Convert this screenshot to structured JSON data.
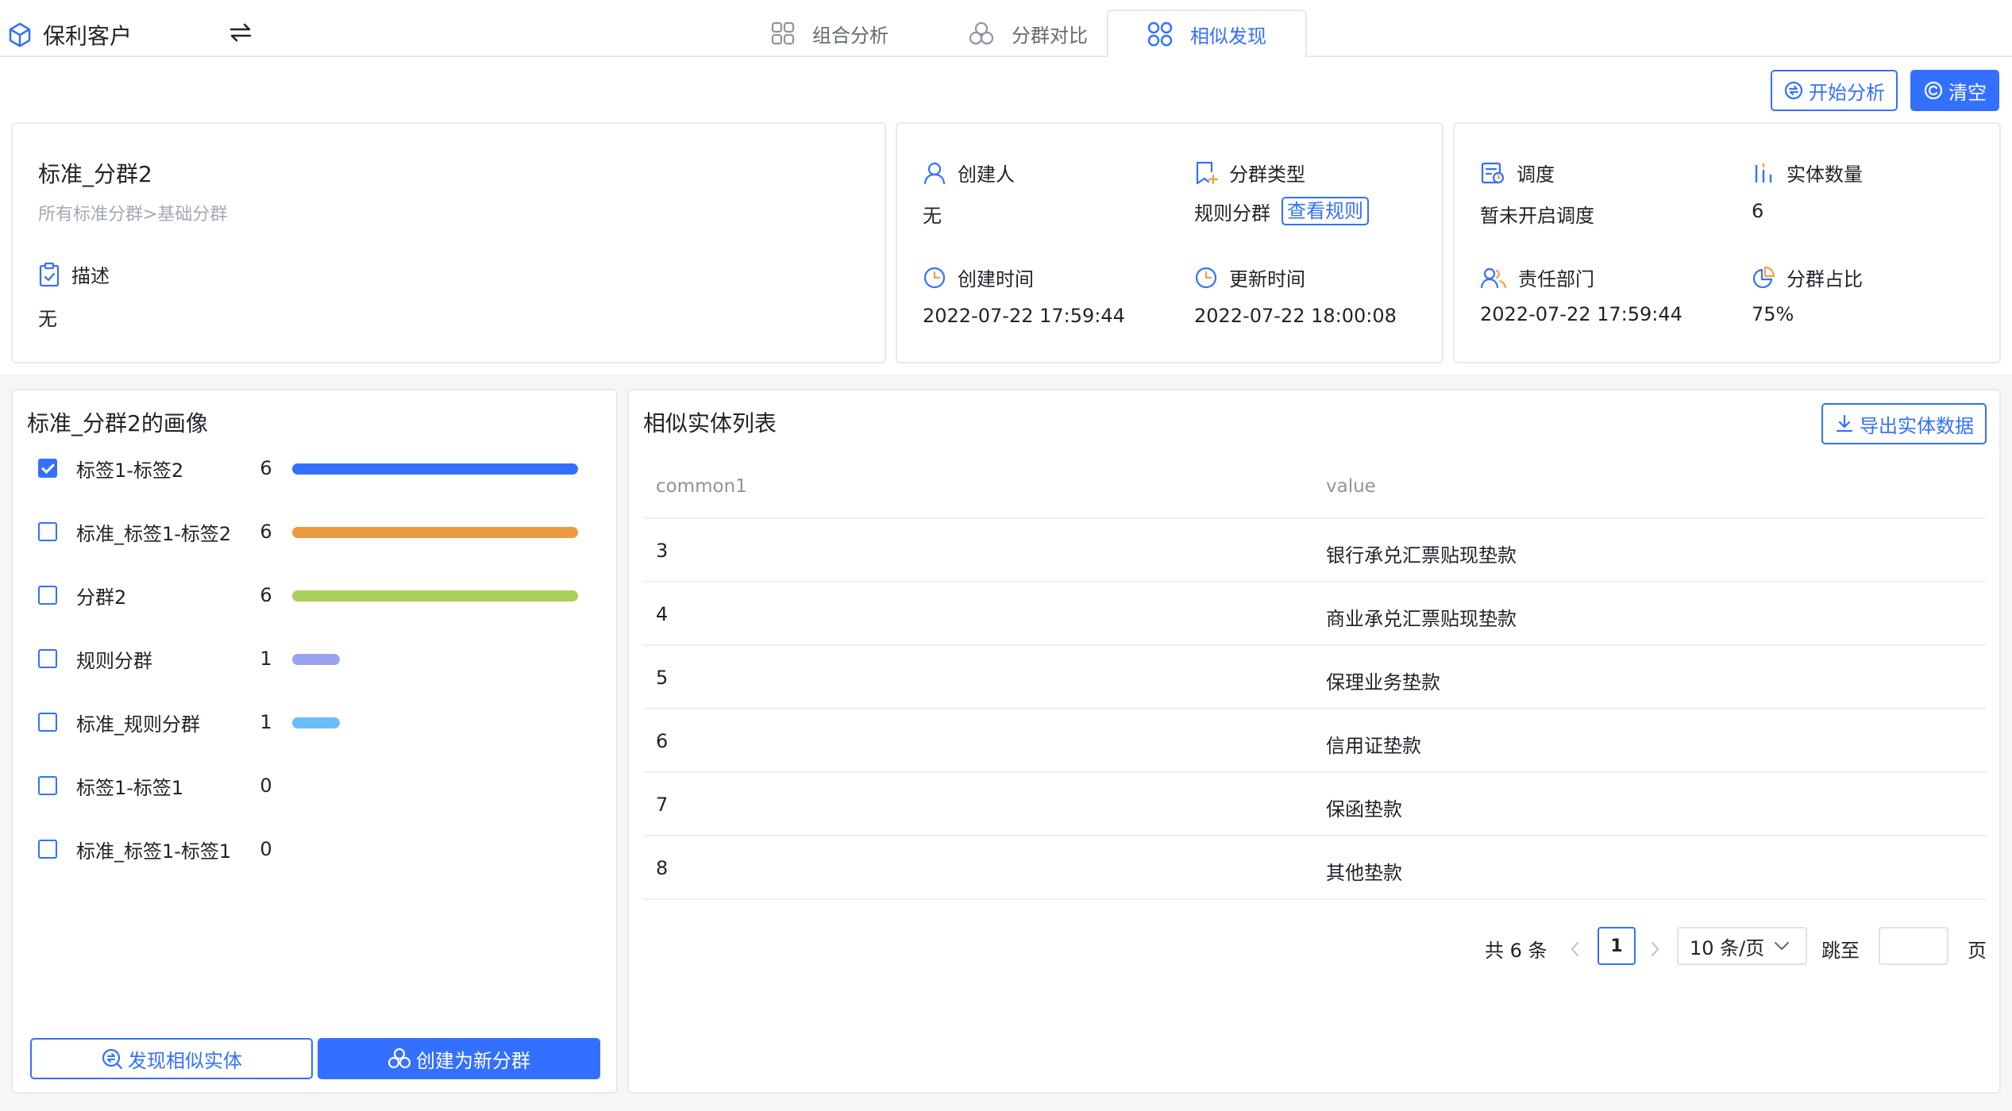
{
  "header": {
    "app_title": "保利客户",
    "tabs": [
      {
        "label": "组合分析",
        "active": false
      },
      {
        "label": "分群对比",
        "active": false
      },
      {
        "label": "相似发现",
        "active": true
      }
    ]
  },
  "actions": {
    "start_analysis": "开始分析",
    "clear": "清空"
  },
  "segment": {
    "name": "标准_分群2",
    "path": "所有标准分群>基础分群",
    "description_label": "描述",
    "description_value": "无"
  },
  "meta1": {
    "creator_label": "创建人",
    "creator_value": "无",
    "type_label": "分群类型",
    "type_value": "规则分群",
    "view_rule": "查看规则",
    "created_label": "创建时间",
    "created_value": "2022-07-22 17:59:44",
    "updated_label": "更新时间",
    "updated_value": "2022-07-22 18:00:08"
  },
  "meta2": {
    "schedule_label": "调度",
    "schedule_value": "暂未开启调度",
    "entity_count_label": "实体数量",
    "entity_count_value": "6",
    "dept_label": "责任部门",
    "dept_value": "2022-07-22 17:59:44",
    "ratio_label": "分群占比",
    "ratio_value": "75%"
  },
  "portrait": {
    "title": "标准_分群2的画像",
    "tags": [
      {
        "label": "标签1-标签2",
        "count": "6",
        "value": 6,
        "checked": true,
        "color": "#3370ff"
      },
      {
        "label": "标准_标签1-标签2",
        "count": "6",
        "value": 6,
        "checked": false,
        "color": "#eb9a3f"
      },
      {
        "label": "分群2",
        "count": "6",
        "value": 6,
        "checked": false,
        "color": "#a8d05a"
      },
      {
        "label": "规则分群",
        "count": "1",
        "value": 1,
        "checked": false,
        "color": "#9aa3ef"
      },
      {
        "label": "标准_规则分群",
        "count": "1",
        "value": 1,
        "checked": false,
        "color": "#6bbdf7"
      },
      {
        "label": "标签1-标签1",
        "count": "0",
        "value": 0,
        "checked": false,
        "color": "#3370ff"
      },
      {
        "label": "标准_标签1-标签1",
        "count": "0",
        "value": 0,
        "checked": false,
        "color": "#3370ff"
      }
    ],
    "find_similar": "发现相似实体",
    "create_segment": "创建为新分群"
  },
  "similar": {
    "title": "相似实体列表",
    "export": "导出实体数据",
    "columns": [
      "common1",
      "value"
    ],
    "rows": [
      [
        "3",
        "银行承兑汇票贴现垫款"
      ],
      [
        "4",
        "商业承兑汇票贴现垫款"
      ],
      [
        "5",
        "保理业务垫款"
      ],
      [
        "6",
        "信用证垫款"
      ],
      [
        "7",
        "保函垫款"
      ],
      [
        "8",
        "其他垫款"
      ]
    ],
    "pagination": {
      "total_text": "共 6 条",
      "current_page": "1",
      "page_size": "10 条/页",
      "jump_label": "跳至",
      "page_suffix": "页",
      "jump_value": ""
    }
  }
}
